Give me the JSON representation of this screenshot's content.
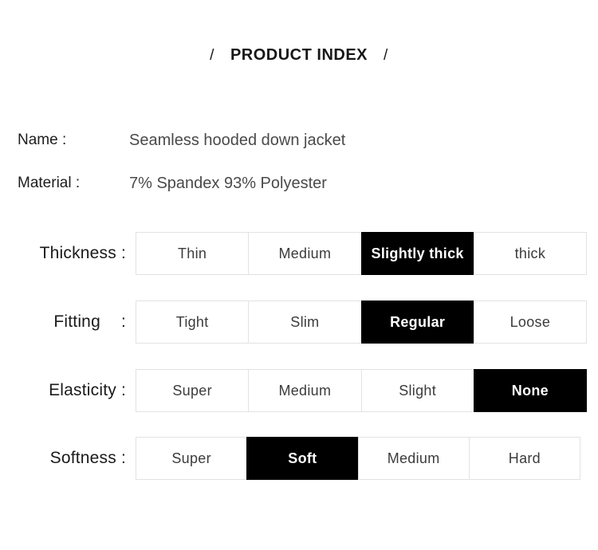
{
  "header": {
    "slash_left": "/",
    "title": "PRODUCT INDEX",
    "slash_right": "/"
  },
  "info": [
    {
      "label": "Name :",
      "value": "Seamless hooded down jacket"
    },
    {
      "label": "Material :",
      "value": "7% Spandex 93% Polyester"
    }
  ],
  "attributes": [
    {
      "label": "Thickness",
      "colon": ":",
      "options": [
        {
          "label": "Thin",
          "selected": false
        },
        {
          "label": "Medium",
          "selected": false
        },
        {
          "label": "Slightly thick",
          "selected": true
        },
        {
          "label": "thick",
          "selected": false
        }
      ]
    },
    {
      "label": "Fitting",
      "colon": ":",
      "options": [
        {
          "label": "Tight",
          "selected": false
        },
        {
          "label": "Slim",
          "selected": false
        },
        {
          "label": "Regular",
          "selected": true
        },
        {
          "label": "Loose",
          "selected": false
        }
      ]
    },
    {
      "label": "Elasticity",
      "colon": ":",
      "options": [
        {
          "label": "Super",
          "selected": false
        },
        {
          "label": "Medium",
          "selected": false
        },
        {
          "label": "Slight",
          "selected": false
        },
        {
          "label": "None",
          "selected": true
        }
      ]
    },
    {
      "label": "Softness",
      "colon": ":",
      "options": [
        {
          "label": "Super",
          "selected": false
        },
        {
          "label": "Soft",
          "selected": true
        },
        {
          "label": "Medium",
          "selected": false
        },
        {
          "label": "Hard",
          "selected": false
        }
      ]
    }
  ],
  "colors": {
    "background": "#ffffff",
    "selected_bg": "#000000",
    "selected_text": "#ffffff",
    "cell_border": "#e2e2e2",
    "label_text": "#1a1a1a",
    "value_text": "#4a4a4a"
  }
}
